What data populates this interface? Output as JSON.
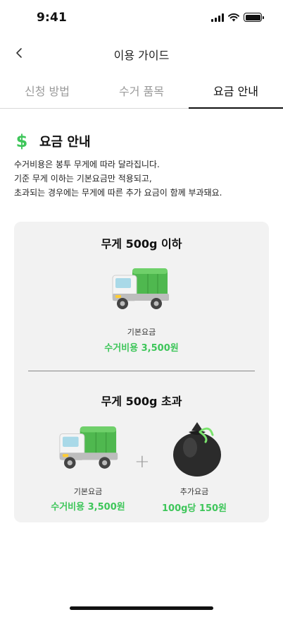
{
  "status_bar": {
    "time": "9:41"
  },
  "nav": {
    "title": "이용 가이드"
  },
  "tabs": [
    {
      "label": "신청 방법",
      "active": false
    },
    {
      "label": "수거 품목",
      "active": false
    },
    {
      "label": "요금 안내",
      "active": true
    }
  ],
  "section": {
    "icon": "dollar-icon",
    "title": "요금 안내",
    "description": [
      "수거비용은 봉투 무게에 따라 달라집니다.",
      "기준 무게 이하는 기본요금만 적용되고,",
      "초과되는 경우에는 무게에 따른 추가 요금이 함께 부과돼요."
    ]
  },
  "card": {
    "under": {
      "heading": "무게 500g 이하",
      "fee_label": "기본요금",
      "fee_value": "수거비용 3,500원"
    },
    "over": {
      "heading": "무게 500g 초과",
      "base_label": "기본요금",
      "base_value": "수거비용 3,500원",
      "plus": "+",
      "extra_label": "추가요금",
      "extra_value": "100g당 150원"
    }
  },
  "colors": {
    "accent": "#3ec65a",
    "card_bg": "#f2f2f2"
  }
}
